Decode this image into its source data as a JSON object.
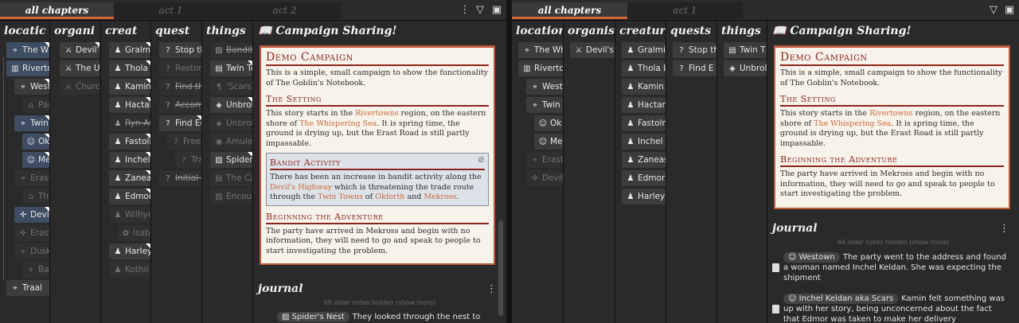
{
  "tabs": [
    "all chapters",
    "act 1",
    "act 2"
  ],
  "toolbar": {
    "menu": "⋮",
    "filter": "▽",
    "window": "▣"
  },
  "left": {
    "columns": [
      "locatic",
      "organi",
      "creat",
      "quest",
      "things"
    ],
    "locations": [
      "The Wh",
      "Riverto",
      "West",
      "Par",
      "Twin",
      "Ok",
      "Me",
      "Erast",
      "The",
      "Devil",
      "Erast",
      "Dusk",
      "Bas",
      "Traal"
    ],
    "organisations": [
      "Devil's",
      "The Ur",
      "Church"
    ],
    "creatures": [
      "Gralmi",
      "Thola L",
      "Kamin",
      "Hactar",
      "Ryn-An",
      "Fastolr",
      "Inchel",
      "Zaneas",
      "Edmor",
      "Wilhye",
      "Isabe",
      "Harley",
      "Kothil"
    ],
    "quests": [
      "Stop th",
      "Restor",
      "Find th",
      "Accom",
      "Find Ec",
      "Free th",
      "Track",
      "Initial I"
    ],
    "things": [
      "Bandit",
      "Twin Te",
      "'Scars'",
      "Unbrok",
      "Unbrok",
      "Amulet",
      "Spider'",
      "The Ca",
      "Encou"
    ]
  },
  "right": {
    "columns": [
      "location:",
      "organisa",
      "creature",
      "quests",
      "things"
    ],
    "locations": [
      "The Wh",
      "Riverto",
      "West",
      "Twin",
      "Ok",
      "Me",
      "Erast",
      "Devil"
    ],
    "organisations": [
      "Devil's"
    ],
    "creatures": [
      "Gralmi",
      "Thola L",
      "Kamin",
      "Hactar",
      "Fastoln",
      "Inchel",
      "Zaneas",
      "Edmor",
      "Harley"
    ],
    "quests": [
      "Stop th",
      "Find E"
    ],
    "things": [
      "Twin T",
      "Unbrol"
    ]
  },
  "campaign": {
    "title": "Campaign Sharing!",
    "doc_title": "Demo Campaign",
    "intro": "This is a simple, small campaign to show the functionality of The Goblin's Notebook.",
    "setting_title": "The Setting",
    "setting_a": "This story starts in the ",
    "setting_link1": "Rivertowns",
    "setting_b": " region, on the eastern shore of ",
    "setting_link2": "The Whispering Sea",
    "setting_c": ". It is spring time, the ground is drying up, but the Erast Road is still partly impassable.",
    "secret_title": "Bandit Activity",
    "secret_a": "There has been an increase in bandit activity along the ",
    "secret_link1": "Devil's Highway",
    "secret_b": " which is threatening the trade route through the ",
    "secret_link2": "Twin Towns",
    "secret_c": " of ",
    "secret_link3": "Okforth",
    "secret_d": " and ",
    "secret_link4": "Mekross",
    "secret_e": ".",
    "begin_title": "Beginning the Adventure",
    "begin_text": "The party have arrived in Mekross and begin with no information, they will need to go and speak to people to start investigating the problem."
  },
  "journal": {
    "title": "journal",
    "left_hidden": "68 older notes hidden (show more)",
    "right_hidden": "44 older notes hidden (show more)",
    "left_note_chip": "Spider's Nest",
    "left_note_text": "They looked through the nest to",
    "note1_chip": "Westown",
    "note1_text": "The party went to the address and found a woman named Inchel Keldan. She was expecting the shipment",
    "note2_chip": "Inchel Keldan aka Scars",
    "note2_text": "Kamin felt something was up with her story, being unconcerned about the fact that Edmor was taken to make her delivery"
  },
  "colors": {
    "accent": "#d0643a",
    "heading": "#8a2621",
    "link": "#c66a3c"
  }
}
